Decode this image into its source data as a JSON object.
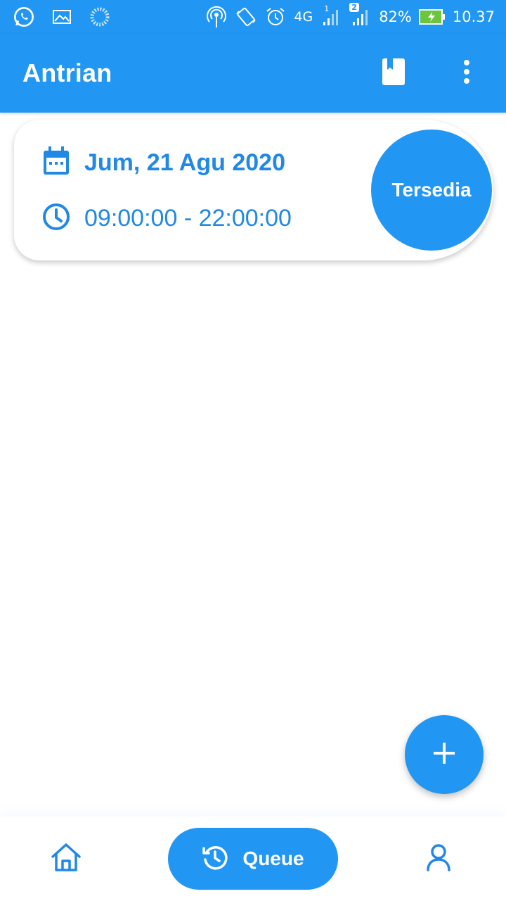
{
  "status_bar": {
    "battery": "82%",
    "time": "10.37",
    "network": "4G",
    "sim1": "1",
    "sim2": "2",
    "icons": [
      "whatsapp-icon",
      "image-icon",
      "loading-icon",
      "hotspot-icon",
      "rotate-icon",
      "alarm-icon",
      "signal-icon",
      "signal-icon",
      "battery-charging-icon"
    ]
  },
  "app_bar": {
    "title": "Antrian",
    "actions": [
      "bookmark-icon",
      "more-vert-icon"
    ]
  },
  "card": {
    "date": "Jum, 21 Agu 2020",
    "time_range": "09:00:00 - 22:00:00",
    "status": "Tersedia"
  },
  "fab": {
    "icon": "plus-icon"
  },
  "bottom_nav": {
    "items": [
      "home-icon",
      "history-icon",
      "person-icon"
    ],
    "active_label": "Queue"
  },
  "colors": {
    "primary": "#2196F3",
    "accent_text": "#2188E6",
    "surface": "#ffffff"
  }
}
